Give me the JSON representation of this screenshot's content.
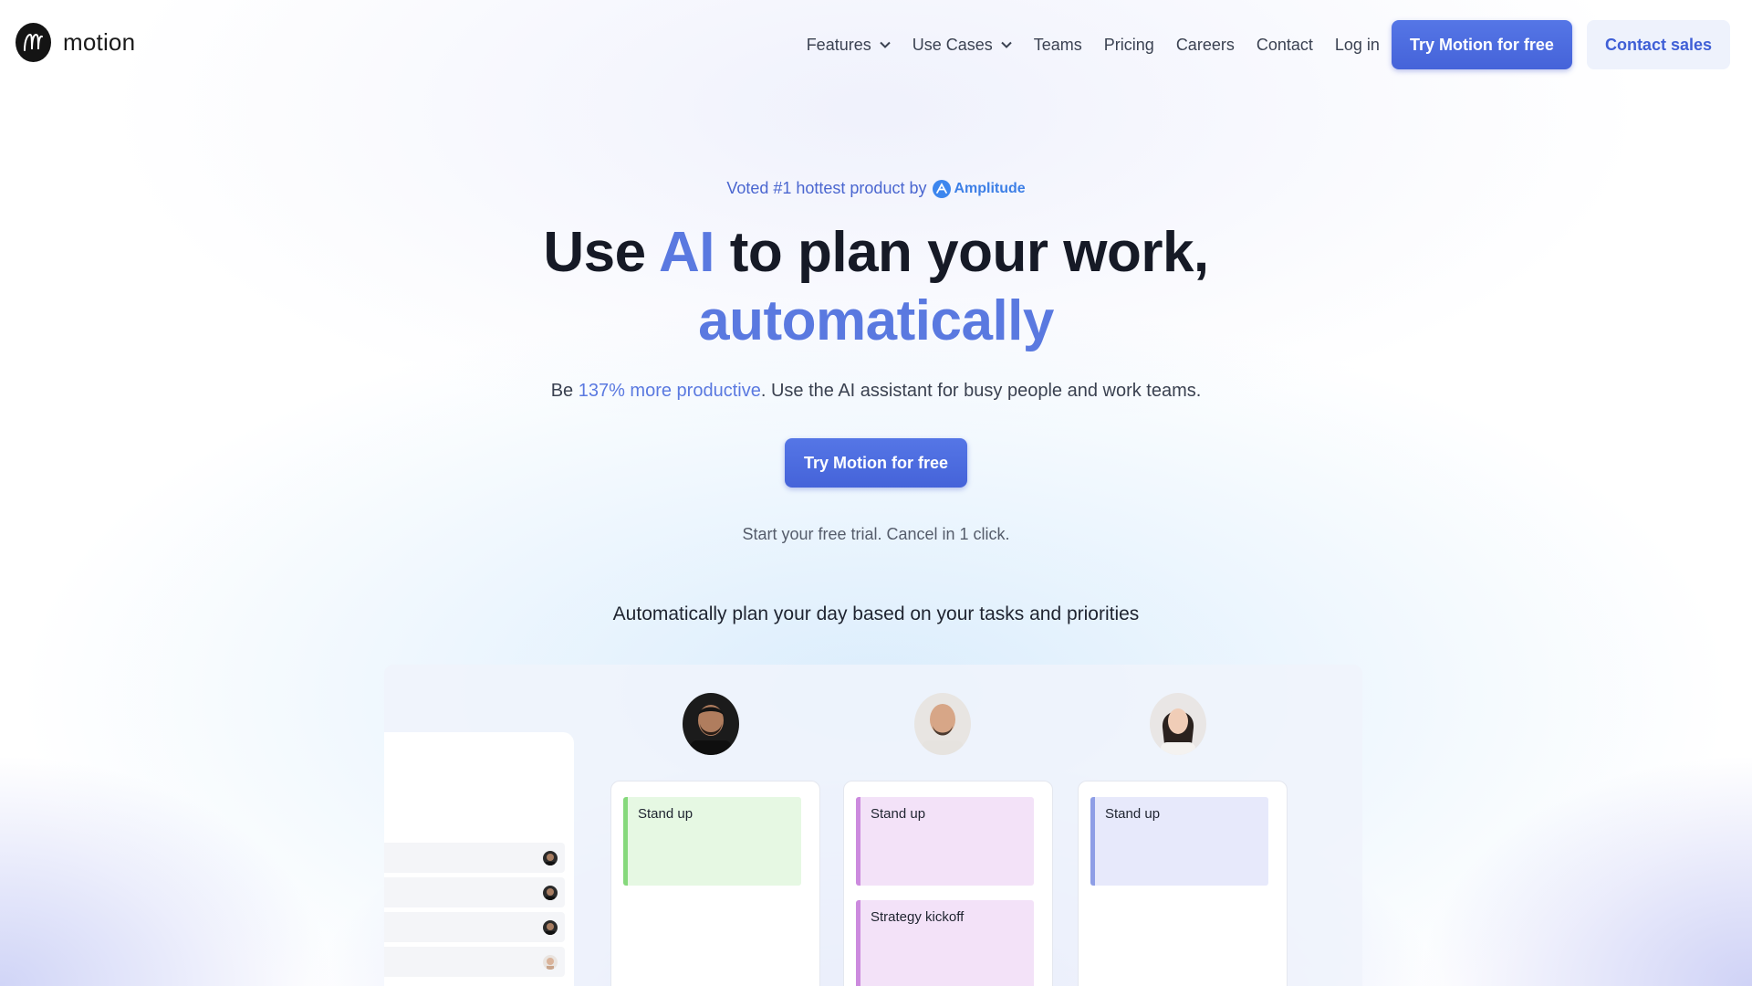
{
  "nav": {
    "logo_text": "motion",
    "items": [
      {
        "label": "Features",
        "dropdown": true
      },
      {
        "label": "Use Cases",
        "dropdown": true
      },
      {
        "label": "Teams",
        "dropdown": false
      },
      {
        "label": "Pricing",
        "dropdown": false
      },
      {
        "label": "Careers",
        "dropdown": false
      },
      {
        "label": "Contact",
        "dropdown": false
      },
      {
        "label": "Log in",
        "dropdown": false
      }
    ],
    "cta_label": "Try Motion for free",
    "contact_sales_label": "Contact sales"
  },
  "hero": {
    "voted_text": "Voted #1 hottest product by",
    "voted_brand": "Amplitude",
    "headline_1": "Use ",
    "headline_accent": "AI",
    "headline_2": " to plan your work,",
    "headline_line2": "automatically",
    "sub_prefix": "Be ",
    "sub_accent": "137% more productive",
    "sub_suffix": ". Use the AI assistant for busy people and work teams.",
    "cta_label": "Try Motion for free",
    "trial_note": "Start your free trial. Cancel in 1 click.",
    "section_caption": "Automatically plan your day based on your tasks and priorities"
  },
  "preview": {
    "columns": [
      {
        "events": [
          "Stand up"
        ],
        "color": "green"
      },
      {
        "events": [
          "Stand up",
          "Strategy kickoff"
        ],
        "color": "pink"
      },
      {
        "events": [
          "Stand up"
        ],
        "color": "blue"
      }
    ]
  },
  "colors": {
    "accent": "#5a79e0",
    "primary_button": "#4b6ee0",
    "secondary_button_bg": "#eef2fc"
  }
}
